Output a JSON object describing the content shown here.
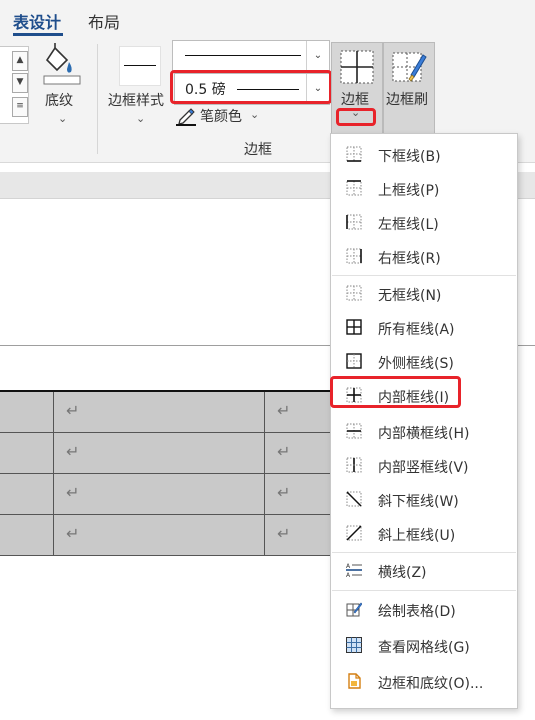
{
  "ribbon": {
    "tabs": [
      {
        "label": "表设计",
        "active": true
      },
      {
        "label": "布局",
        "active": false
      }
    ],
    "shading_label": "底纹",
    "border_styles_label": "边框样式",
    "pen_weight_value": "0.5 磅",
    "pen_color_label": "笔颜色",
    "borders_label": "边框",
    "border_painter_label": "边框刷",
    "group_label": "边框"
  },
  "document": {
    "table_cell_marker": "↵"
  },
  "menu": {
    "items": [
      {
        "label": "下框线(B)",
        "icon": "bottom-border-icon"
      },
      {
        "label": "上框线(P)",
        "icon": "top-border-icon"
      },
      {
        "label": "左框线(L)",
        "icon": "left-border-icon"
      },
      {
        "label": "右框线(R)",
        "icon": "right-border-icon"
      },
      {
        "label": "无框线(N)",
        "icon": "no-border-icon"
      },
      {
        "label": "所有框线(A)",
        "icon": "all-borders-icon"
      },
      {
        "label": "外侧框线(S)",
        "icon": "outside-borders-icon"
      },
      {
        "label": "内部框线(I)",
        "icon": "inside-borders-icon"
      },
      {
        "label": "内部横框线(H)",
        "icon": "inside-horizontal-border-icon"
      },
      {
        "label": "内部竖框线(V)",
        "icon": "inside-vertical-border-icon"
      },
      {
        "label": "斜下框线(W)",
        "icon": "diagonal-down-border-icon"
      },
      {
        "label": "斜上框线(U)",
        "icon": "diagonal-up-border-icon"
      },
      {
        "label": "横线(Z)",
        "icon": "horizontal-line-icon"
      },
      {
        "label": "绘制表格(D)",
        "icon": "draw-table-icon"
      },
      {
        "label": "查看网格线(G)",
        "icon": "view-gridlines-icon"
      },
      {
        "label": "边框和底纹(O)...",
        "icon": "borders-and-shading-icon"
      }
    ]
  },
  "colors": {
    "highlight": "#e8232a",
    "accent": "#1f4e8c",
    "table_fill": "#c9c9c9"
  }
}
